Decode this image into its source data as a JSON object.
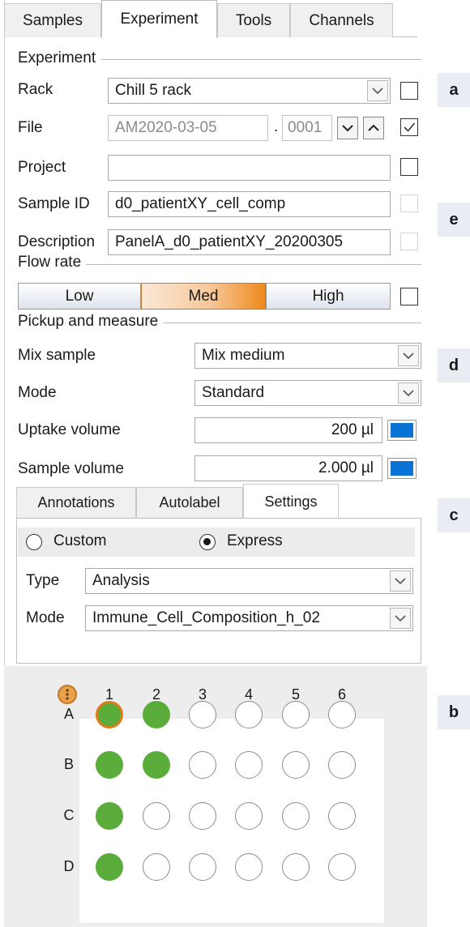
{
  "tabs": [
    "Samples",
    "Experiment",
    "Tools",
    "Channels"
  ],
  "experiment": {
    "section_label": "Experiment",
    "rack_label": "Rack",
    "rack_value": "Chill 5 rack",
    "file_label": "File",
    "file_value": "AM2020-03-05",
    "file_sep": ".",
    "file_number": "0001",
    "project_label": "Project",
    "project_value": "",
    "sample_id_label": "Sample ID",
    "sample_id_value": "d0_patientXY_cell_comp",
    "description_label": "Description",
    "description_value": "PanelA_d0_patientXY_20200305"
  },
  "flow_rate": {
    "section_label": "Flow rate",
    "options": [
      "Low",
      "Med",
      "High"
    ],
    "selected": "Med"
  },
  "pickup": {
    "section_label": "Pickup and measure",
    "mix_label": "Mix sample",
    "mix_value": "Mix medium",
    "mode_label": "Mode",
    "mode_value": "Standard",
    "uptake_label": "Uptake volume",
    "uptake_value": "200 µl",
    "sample_label": "Sample volume",
    "sample_value": "2.000 µl",
    "accent_color": "#0a74d4"
  },
  "inner_tabs": [
    "Annotations",
    "Autolabel",
    "Settings"
  ],
  "settings": {
    "custom_label": "Custom",
    "express_label": "Express",
    "selected": "Express",
    "type_label": "Type",
    "type_value": "Analysis",
    "mode_label": "Mode",
    "mode_value": "Immune_Cell_Composition_h_02"
  },
  "plate": {
    "columns": [
      "1",
      "2",
      "3",
      "4",
      "5",
      "6"
    ],
    "rows": [
      "A",
      "B",
      "C",
      "D"
    ],
    "filled_wells": [
      "A1",
      "A2",
      "B1",
      "B2",
      "C1",
      "D1"
    ],
    "selected_well": "A1",
    "fill_color": "#5aad3a",
    "selected_color": "#e07b1a"
  },
  "side_labels": [
    "a",
    "e",
    "d",
    "c",
    "b"
  ]
}
